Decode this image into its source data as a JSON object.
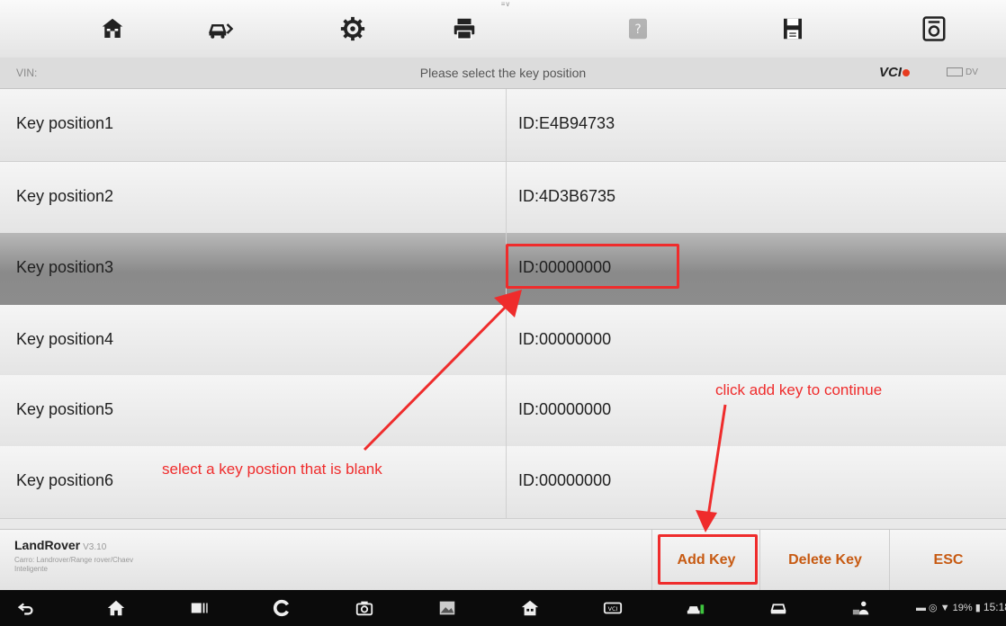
{
  "toolbar": {
    "icons": [
      "home-icon",
      "vehicle-swap-icon",
      "settings-icon",
      "print-icon",
      "help-icon",
      "save-icon",
      "vci-status-icon"
    ],
    "pull_tab": "≡∨"
  },
  "status": {
    "vin_label": "VIN:",
    "title": "Please select the key position",
    "vci_label": "VCI",
    "battery_label": "DV"
  },
  "table": {
    "rows": [
      {
        "name": "Key position1",
        "id": "ID:E4B94733",
        "selected": false
      },
      {
        "name": "Key position2",
        "id": "ID:4D3B6735",
        "selected": false
      },
      {
        "name": "Key position3",
        "id": "ID:00000000",
        "selected": true
      },
      {
        "name": "Key position4",
        "id": "ID:00000000",
        "selected": false
      },
      {
        "name": "Key position5",
        "id": "ID:00000000",
        "selected": false
      },
      {
        "name": "Key position6",
        "id": "ID:00000000",
        "selected": false
      }
    ]
  },
  "bottom": {
    "brand": "LandRover",
    "version": "V3.10",
    "path_line1": "Carro: Landrover/Range rover/Chaev",
    "path_line2": "Inteligente",
    "add_key": "Add Key",
    "delete_key": "Delete Key",
    "esc": "ESC"
  },
  "navbar": {
    "icons": [
      "back-icon",
      "home-icon",
      "recent-apps-icon",
      "browser-icon",
      "camera-icon",
      "gallery-icon",
      "app-home-icon",
      "vci-icon",
      "car-diagnostic-icon",
      "car-icon",
      "user-manager-icon"
    ],
    "battery": "19%",
    "time": "15:18"
  },
  "annotations": {
    "select_hint": "select a key postion that is blank",
    "add_hint": "click add key to continue"
  },
  "colors": {
    "accent_orange": "#c75a12",
    "annotation_red": "#ef2c2c",
    "selected_row": "#8a8a8a"
  }
}
